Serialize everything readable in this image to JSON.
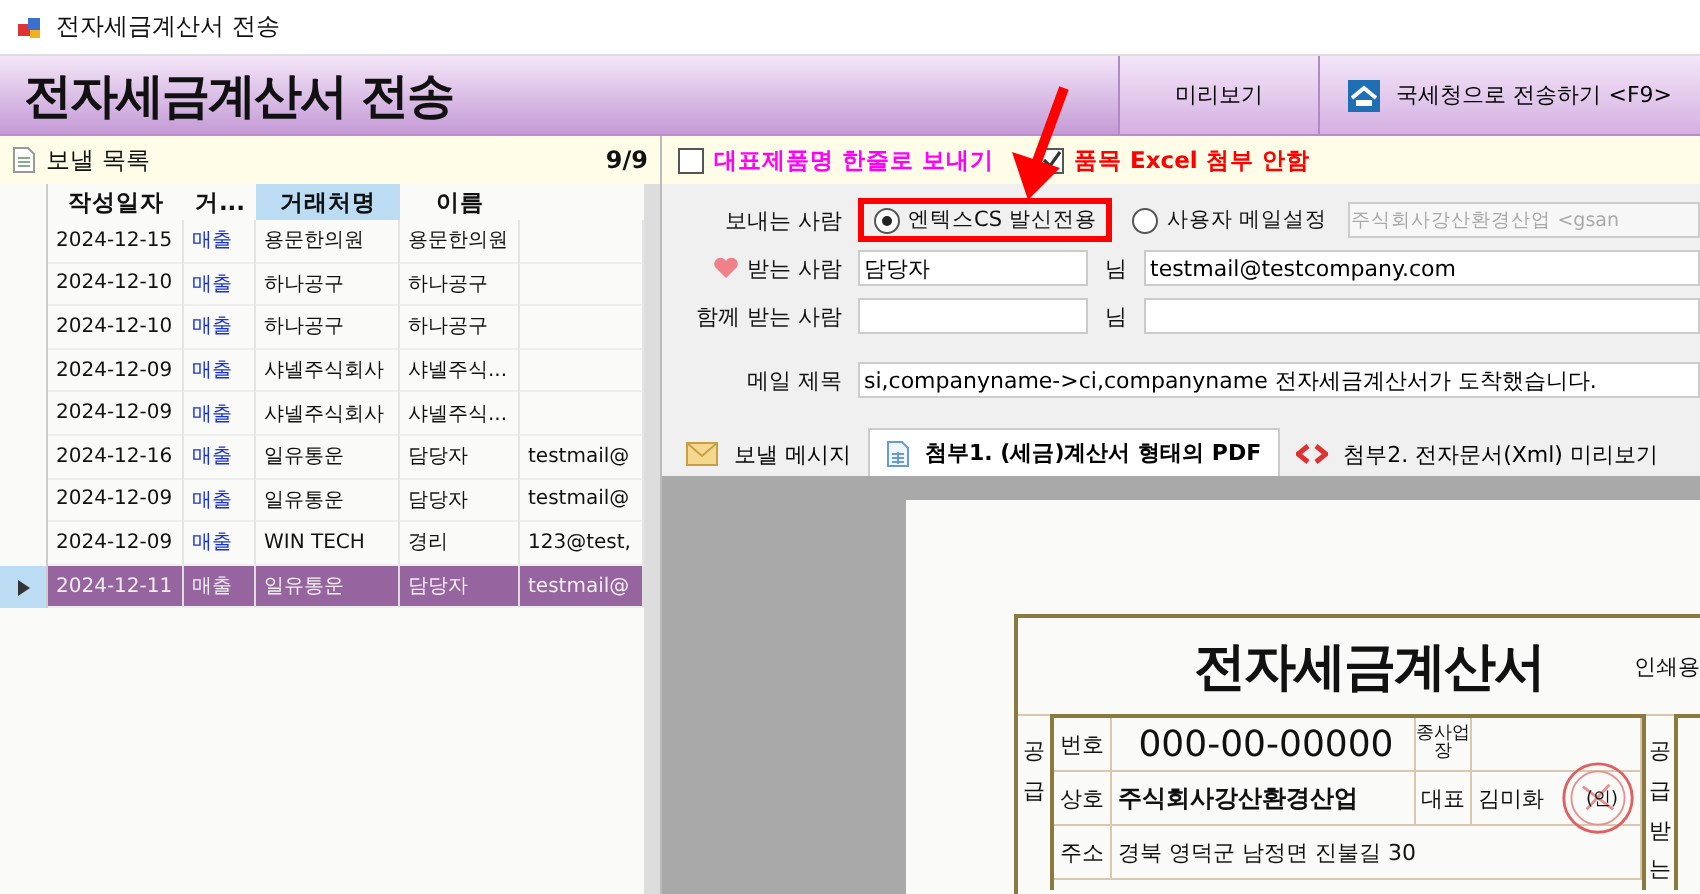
{
  "window": {
    "title": "전자세금계산서 전송"
  },
  "header": {
    "title": "전자세금계산서 전송",
    "buttons": [
      {
        "label": "미리보기",
        "kind": "plain"
      },
      {
        "label": "국세청으로 전송하기 <F9>",
        "kind": "nts"
      }
    ]
  },
  "send_list": {
    "title": "보낼 목록",
    "count": "9/9",
    "columns": [
      {
        "label": "작성일자",
        "selected": false
      },
      {
        "label": "거...",
        "selected": false
      },
      {
        "label": "거래처명",
        "selected": true
      },
      {
        "label": "이름",
        "selected": false
      }
    ],
    "rows": [
      {
        "date": "2024-12-15",
        "type": "매출",
        "partner": "용문한의원",
        "name": "용문한의원",
        "email": "",
        "selected": false
      },
      {
        "date": "2024-12-10",
        "type": "매출",
        "partner": "하나공구",
        "name": "하나공구",
        "email": "",
        "selected": false
      },
      {
        "date": "2024-12-10",
        "type": "매출",
        "partner": "하나공구",
        "name": "하나공구",
        "email": "",
        "selected": false
      },
      {
        "date": "2024-12-09",
        "type": "매출",
        "partner": "샤넬주식회사",
        "name": "샤넬주식...",
        "email": "",
        "selected": false
      },
      {
        "date": "2024-12-09",
        "type": "매출",
        "partner": "샤넬주식회사",
        "name": "샤넬주식...",
        "email": "",
        "selected": false
      },
      {
        "date": "2024-12-16",
        "type": "매출",
        "partner": "일유통운",
        "name": "담당자",
        "email": "testmail@",
        "selected": false
      },
      {
        "date": "2024-12-09",
        "type": "매출",
        "partner": "일유통운",
        "name": "담당자",
        "email": "testmail@",
        "selected": false
      },
      {
        "date": "2024-12-09",
        "type": "매출",
        "partner": "WIN TECH",
        "name": "경리",
        "email": "123@test,",
        "selected": false
      },
      {
        "date": "2024-12-11",
        "type": "매출",
        "partner": "일유통운",
        "name": "담당자",
        "email": "testmail@",
        "selected": true
      }
    ]
  },
  "options": [
    {
      "label": "대표제품명 한줄로 보내기",
      "checked": false,
      "color": "#ff00ff"
    },
    {
      "label": "품목 Excel 첨부 안함",
      "checked": true,
      "color": "#ff0000"
    }
  ],
  "mail": {
    "sender_label": "보내는 사람",
    "sender_options": [
      {
        "label": "엔텍스CS 발신전용",
        "selected": true,
        "highlighted": true
      },
      {
        "label": "사용자 메일설정",
        "selected": false,
        "highlighted": false
      }
    ],
    "sender_field": {
      "value": "주식회사강산환경산업 <gsan",
      "disabled": true
    },
    "recipient_label": "받는 사람",
    "recipient_name": "담당자",
    "recipient_suffix": "님",
    "recipient_email": "testmail@testcompany.com",
    "cc_label": "함께 받는 사람",
    "cc_suffix": "님",
    "subject_label": "메일 제목",
    "subject": "si,companyname->ci,companyname 전자세금계산서가 도착했습니다."
  },
  "tabs": [
    {
      "label": "보낼 메시지",
      "kind": "message",
      "selected": false
    },
    {
      "label": "첨부1. (세금)계산서 형태의 PDF",
      "kind": "pdf",
      "selected": true
    },
    {
      "label": "첨부2. 전자문서(Xml) 미리보기",
      "kind": "xml",
      "selected": false
    }
  ],
  "document": {
    "title": "전자세금계산서",
    "print_label": "인쇄용",
    "supplier_label": "공급",
    "buyer_label": "공급받는",
    "reg_label": "번호",
    "reg_number": "000-00-00000",
    "branch_label": "종사업장",
    "company_label": "상호",
    "company": "주식회사강산환경산업",
    "ceo_label": "대표",
    "ceo": "김미화",
    "seal": "(인)",
    "address_label": "주소",
    "address": "경북 영덕군 남정면 진불길 30"
  }
}
